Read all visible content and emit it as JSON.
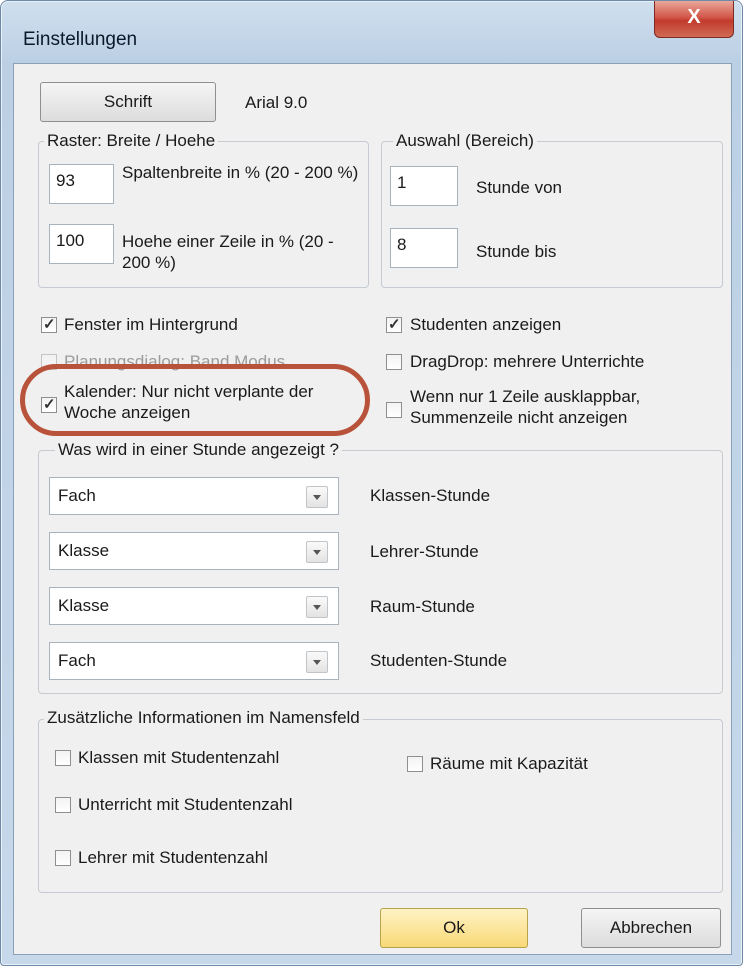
{
  "window": {
    "title": "Einstellungen",
    "close_label": "X"
  },
  "font": {
    "button_label": "Schrift",
    "current": "Arial 9.0"
  },
  "raster": {
    "legend": "Raster: Breite / Hoehe",
    "col_width_value": "93",
    "col_width_label": "Spaltenbreite in % (20 - 200 %)",
    "row_height_value": "100",
    "row_height_label": "Hoehe einer Zeile in % (20 - 200 %)"
  },
  "auswahl": {
    "legend": "Auswahl (Bereich)",
    "from_value": "1",
    "from_label": "Stunde von",
    "to_value": "8",
    "to_label": "Stunde bis"
  },
  "options": {
    "fenster": {
      "label": "Fenster im Hintergrund",
      "checked": true
    },
    "planung": {
      "label": "Planungsdialog: Band Modus",
      "checked": false,
      "disabled": true
    },
    "kalender": {
      "label": "Kalender: Nur nicht verplante der Woche anzeigen",
      "checked": true
    },
    "studenten": {
      "label": "Studenten anzeigen",
      "checked": true
    },
    "dragdrop": {
      "label": "DragDrop: mehrere Unterrichte",
      "checked": false
    },
    "wenn": {
      "label": "Wenn nur 1 Zeile ausklappbar, Summenzeile nicht anzeigen",
      "checked": false
    }
  },
  "stunde": {
    "legend": "Was wird in einer Stunde angezeigt ?",
    "rows": [
      {
        "value": "Fach",
        "label": "Klassen-Stunde"
      },
      {
        "value": "Klasse",
        "label": "Lehrer-Stunde"
      },
      {
        "value": "Klasse",
        "label": "Raum-Stunde"
      },
      {
        "value": "Fach",
        "label": "Studenten-Stunde"
      }
    ]
  },
  "namensfeld": {
    "legend": "Zusätzliche Informationen im Namensfeld",
    "klassen": "Klassen mit Studentenzahl",
    "unterricht": "Unterricht mit Studentenzahl",
    "lehrer": "Lehrer mit Studentenzahl",
    "raeume": "Räume mit Kapazität"
  },
  "buttons": {
    "ok": "Ok",
    "cancel": "Abbrechen"
  },
  "colors": {
    "highlight": "#b8523a",
    "ok_button": "#f8d978",
    "close_button": "#c23b2c"
  }
}
